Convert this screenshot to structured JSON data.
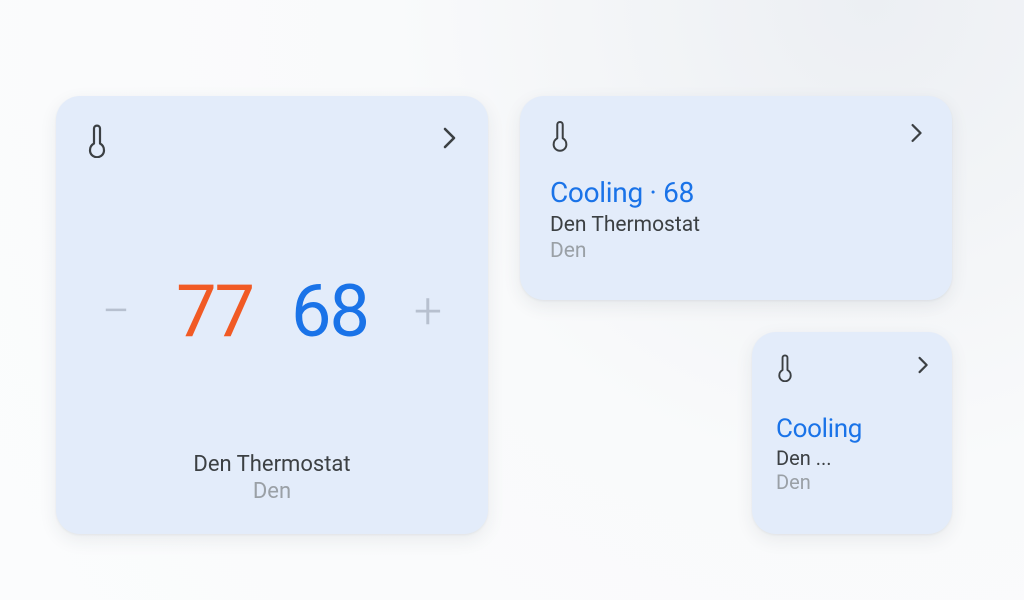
{
  "colors": {
    "card_bg": "#e3ecfa",
    "heat": "#f15a24",
    "cool": "#1a73e8",
    "text_primary": "#3c4043",
    "text_secondary": "#9aa0a6",
    "icon": "#3c4043",
    "btn_disabled": "#b7c0cf"
  },
  "large_card": {
    "icon": "thermometer",
    "heat_setpoint": "77",
    "cool_setpoint": "68",
    "device_name": "Den Thermostat",
    "room": "Den",
    "decrease_label": "−",
    "increase_label": "+"
  },
  "medium_card": {
    "icon": "thermometer",
    "status_line": "Cooling · 68",
    "device_name": "Den Thermostat",
    "room": "Den"
  },
  "small_card": {
    "icon": "thermometer",
    "status_line": "Cooling",
    "device_name": "Den ...",
    "room": "Den"
  }
}
